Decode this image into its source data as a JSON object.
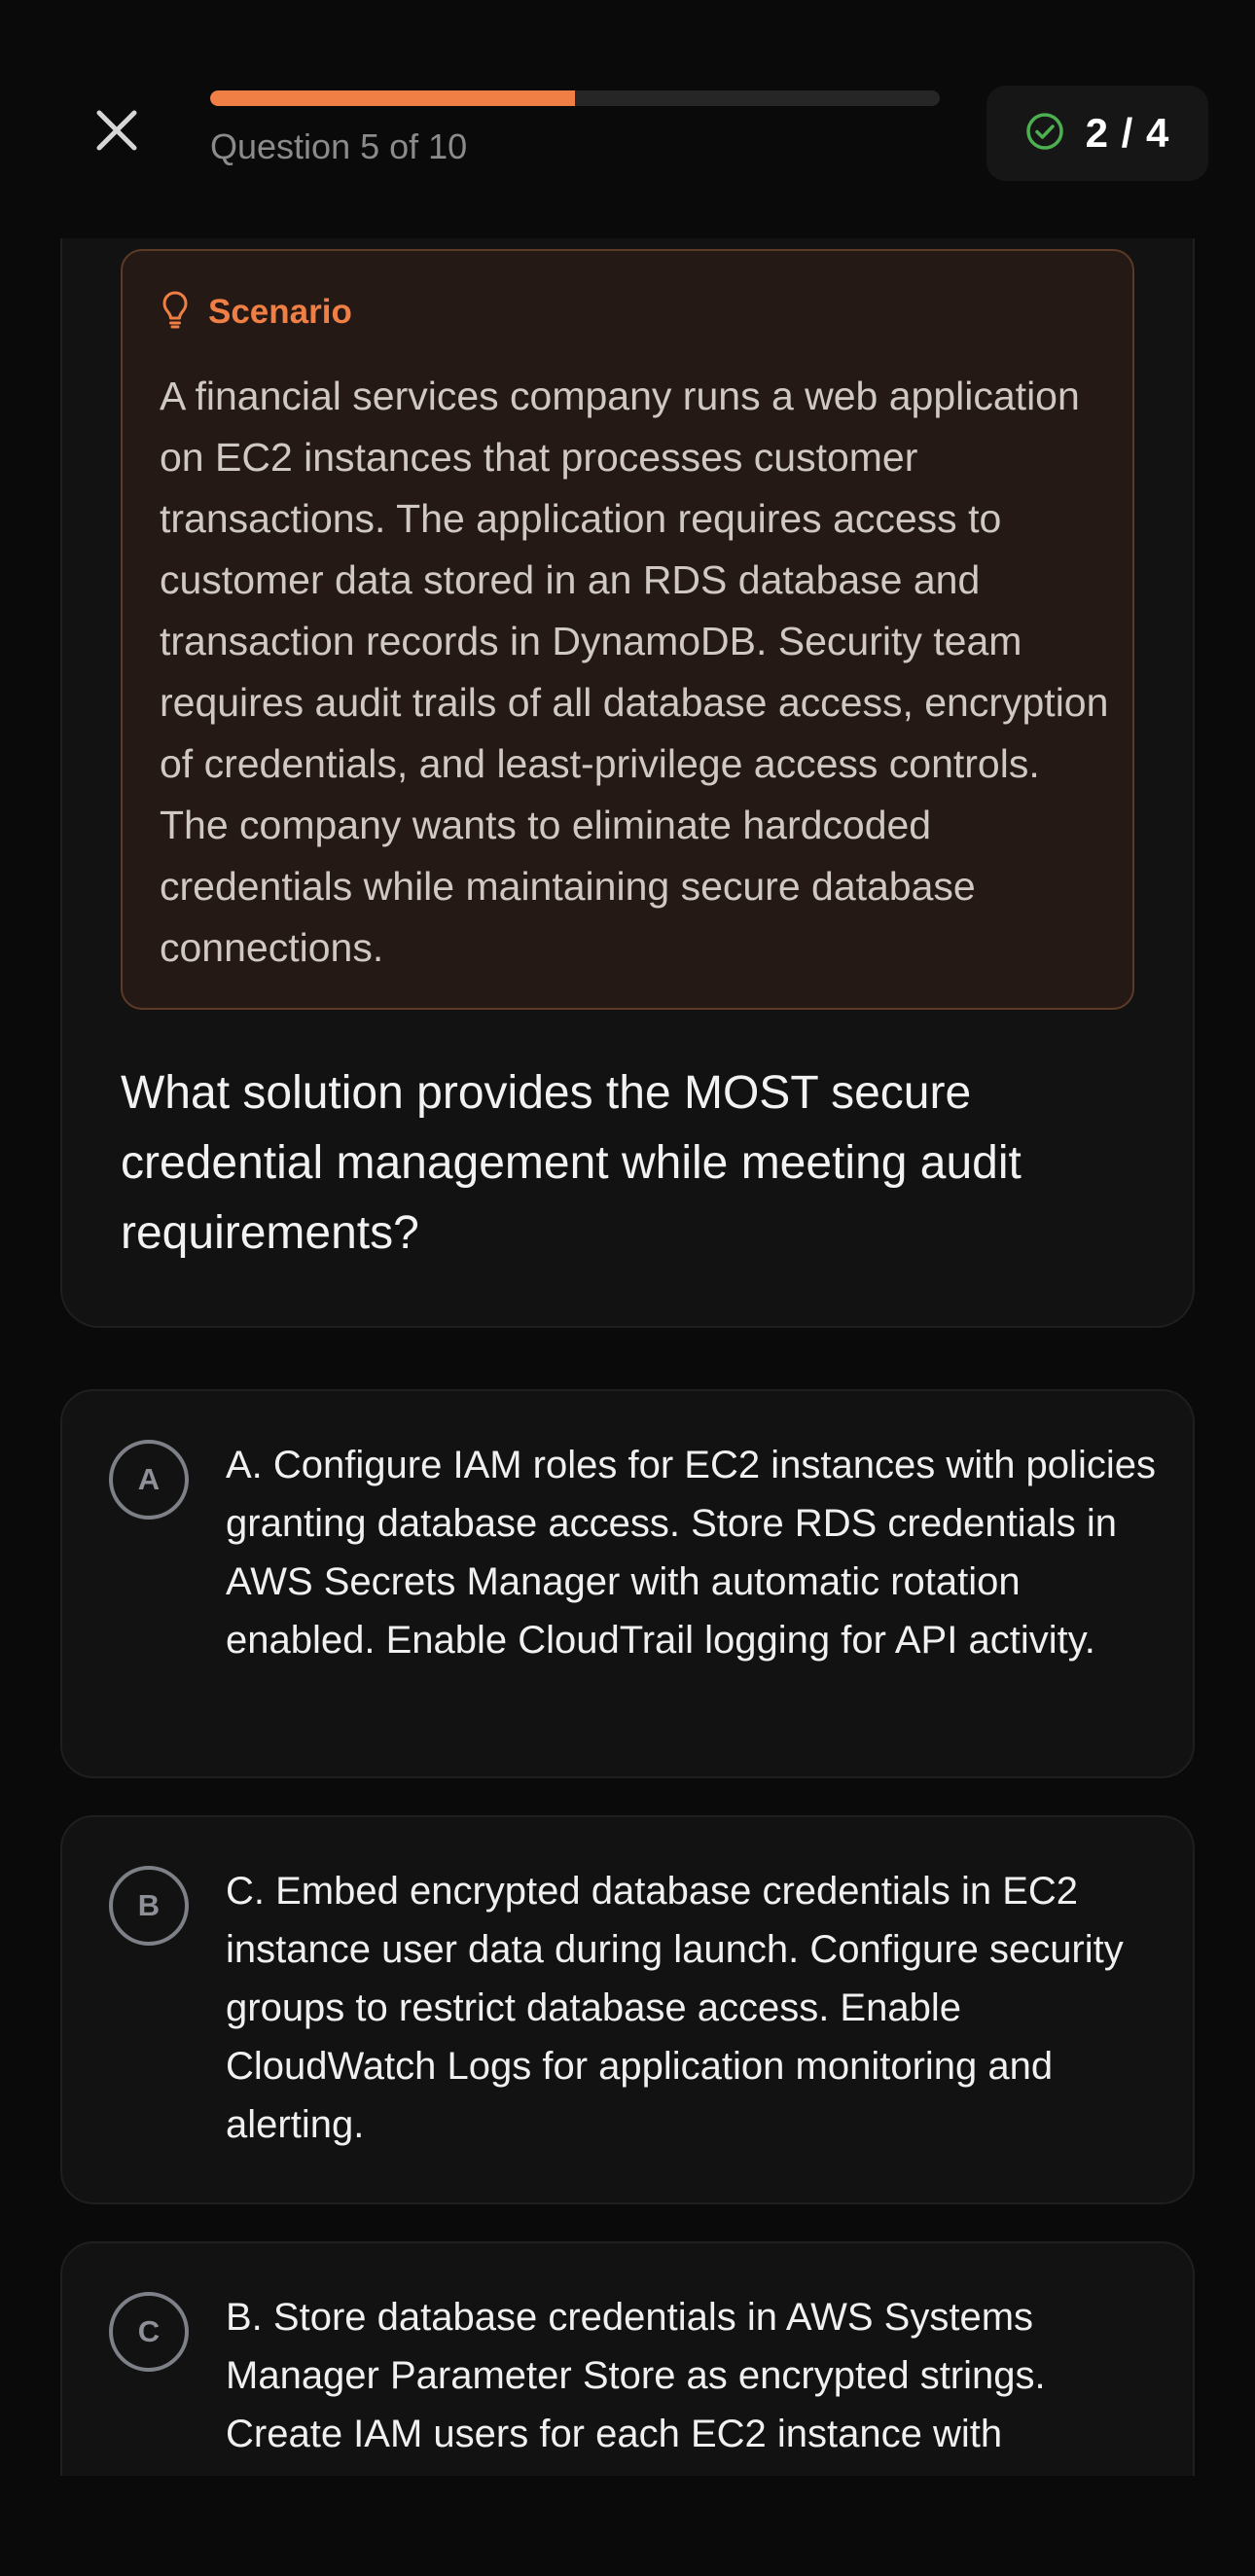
{
  "header": {
    "progress_label": "Question 5 of 10",
    "progress_fraction": 0.5,
    "score": "2 / 4"
  },
  "scenario": {
    "title": "Scenario",
    "text": "A financial services company runs a web application on EC2 instances that processes customer transactions. The application requires access to customer data stored in an RDS database and transaction records in DynamoDB. Security team requires audit trails of all database access, encryption of credentials, and least-privilege access controls. The company wants to eliminate hardcoded credentials while maintaining secure database connections."
  },
  "question": "What solution provides the MOST secure credential management while meeting audit requirements?",
  "options": [
    {
      "letter": "A",
      "text": "A. Configure IAM roles for EC2 instances with policies granting database access. Store RDS credentials in AWS Secrets Manager with automatic rotation enabled. Enable CloudTrail logging for API activity."
    },
    {
      "letter": "B",
      "text": "C. Embed encrypted database credentials in EC2 instance user data during launch. Configure security groups to restrict database access. Enable CloudWatch Logs for application monitoring and alerting."
    },
    {
      "letter": "C",
      "text": "B. Store database credentials in AWS Systems Manager Parameter Store as encrypted strings. Create IAM users for each EC2 instance with"
    }
  ],
  "colors": {
    "accent": "#f07f45",
    "success": "#4caf50",
    "background": "#0a0a0a",
    "card": "#121212"
  },
  "icons": {
    "close": "close-icon",
    "score": "check-circle-icon",
    "scenario": "lightbulb-icon"
  }
}
